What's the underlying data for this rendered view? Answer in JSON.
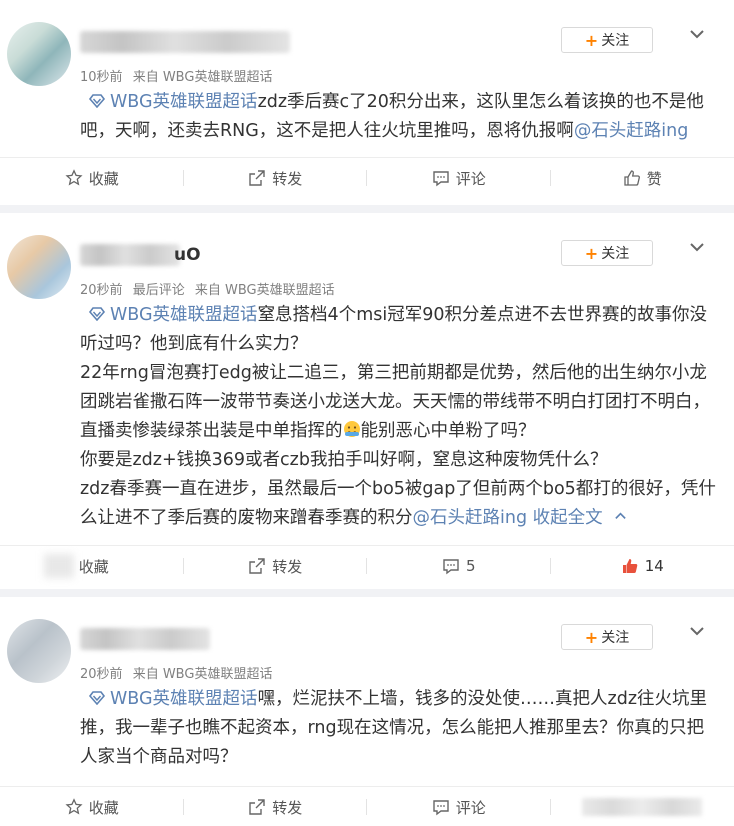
{
  "comments": [
    {
      "name_suffix": "",
      "time": "10秒前",
      "source": "来自 WBG英雄联盟超话",
      "follow_label": "关注",
      "topic": "WBG英雄联盟超话",
      "text": "zdz季后赛c了20积分出来，这队里怎么着该换的也不是他吧，天啊，还卖去RNG，这不是把人往火坑里推吗，恩将仇报啊",
      "mention": "@石头赶路ing",
      "actions": {
        "favorite": "收藏",
        "repost": "转发",
        "comment": "评论",
        "like": "赞"
      }
    },
    {
      "name_suffix": "uO",
      "time": "20秒前",
      "extra": "最后评论",
      "source": "来自 WBG英雄联盟超话",
      "follow_label": "关注",
      "topic": "WBG英雄联盟超话",
      "text_a": "窒息搭档4个msi冠军90积分差点进不去世界赛的故事你没听过吗？他到底有什么实力？",
      "text_b": "22年rng冒泡赛打edg被让二追三，第三把前期都是优势，然后他的出生纳尔小龙团跳岩雀撒石阵一波带节奏送小龙送大龙。天天懦的带线带不明白打团打不明白，直播卖惨装绿茶出装是中单指挥的",
      "text_c": "能别恶心中单粉了吗？",
      "text_d": "你要是zdz+钱换369或者czb我拍手叫好啊，窒息这种废物凭什么？",
      "text_e": "zdz春季赛一直在进步，虽然最后一个bo5被gap了但前两个bo5都打的很好，凭什么让进不了季后赛的废物来蹭春季赛的积分",
      "mention": "@石头赶路ing",
      "expand": "收起全文",
      "actions": {
        "favorite": "收藏",
        "repost": "转发",
        "comment_count": "5",
        "like_count": "14"
      }
    },
    {
      "name_suffix": "",
      "time": "20秒前",
      "source": "来自 WBG英雄联盟超话",
      "follow_label": "关注",
      "topic": "WBG英雄联盟超话",
      "text": "嘿，烂泥扶不上墙，钱多的没处使……真把人zdz往火坑里推，我一辈子也瞧不起资本，rng现在这情况，怎么能把人推那里去？你真的只把人家当个商品对吗？",
      "actions": {
        "favorite": "收藏",
        "repost": "转发",
        "comment": "评论"
      }
    }
  ],
  "colors": {
    "topic": "#5d82b3",
    "follow_plus": "#ff8200",
    "liked": "#e8513c",
    "background": "#f1f2f5"
  },
  "icons": [
    "diamond-topic-icon",
    "star-icon",
    "share-icon",
    "comment-icon",
    "thumb-up-icon",
    "chevron-down-icon",
    "emoji-icon"
  ]
}
